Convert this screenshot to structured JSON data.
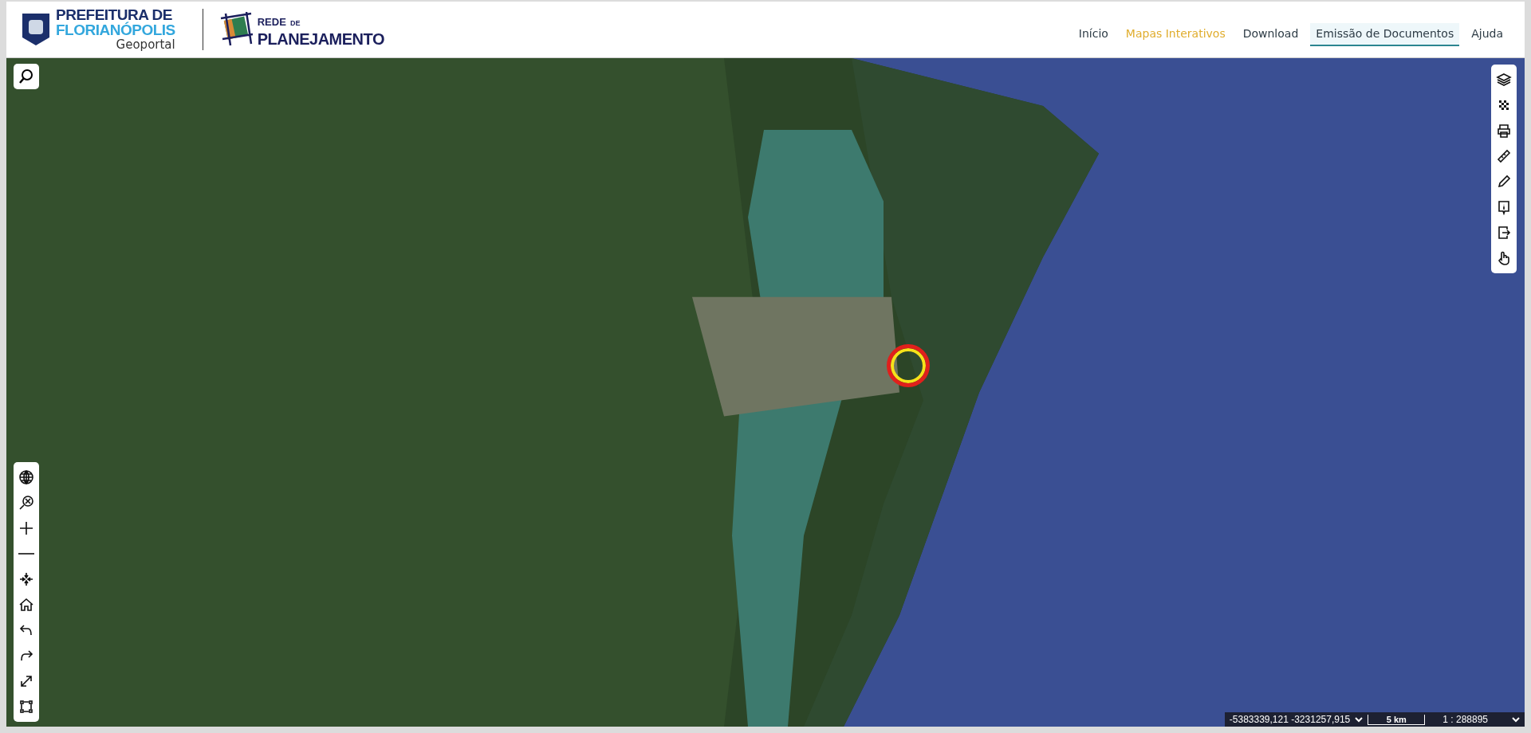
{
  "header": {
    "logo_line1": "PREFEITURA DE",
    "logo_line2": "FLORIANÓPOLIS",
    "logo_subtitle": "Geoportal",
    "partner_word": "REDE",
    "partner_small": "DE",
    "partner_line2": "PLANEJAMENTO"
  },
  "nav": [
    {
      "label": "Início",
      "selected": false,
      "underlined": false
    },
    {
      "label": "Mapas Interativos",
      "selected": true,
      "underlined": false
    },
    {
      "label": "Download",
      "selected": false,
      "underlined": false
    },
    {
      "label": "Emissão de Documentos",
      "selected": false,
      "underlined": true
    },
    {
      "label": "Ajuda",
      "selected": false,
      "underlined": false
    }
  ],
  "status_bar": {
    "coordinates": "-5383339,121 -3231257,915",
    "scale_label": "5 km",
    "scale_ratio": "1 : 288895"
  }
}
